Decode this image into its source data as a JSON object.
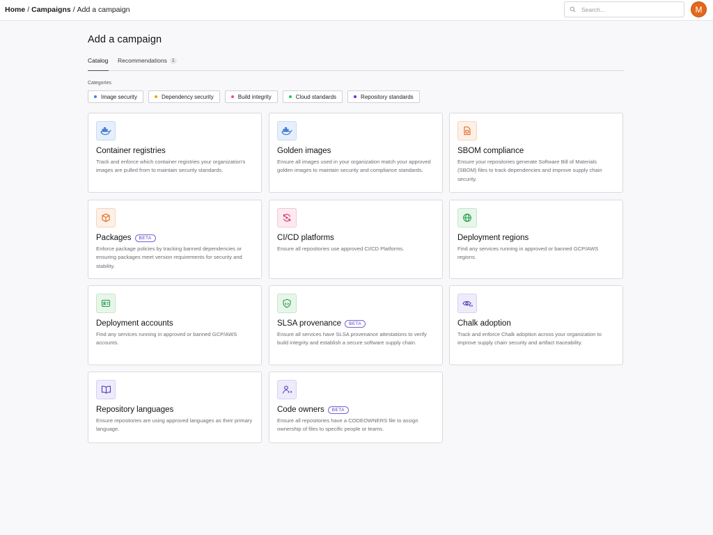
{
  "breadcrumb": {
    "home": "Home",
    "campaigns": "Campaigns",
    "current": "Add a campaign",
    "separator": "/"
  },
  "search": {
    "placeholder": "Search..."
  },
  "user": {
    "avatar_initial": "M",
    "avatar_color": "#e2681d"
  },
  "page": {
    "title": "Add a campaign"
  },
  "tabs": [
    {
      "label": "Catalog",
      "active": true
    },
    {
      "label": "Recommendations",
      "count": "1",
      "active": false
    }
  ],
  "categories": {
    "label": "Categories",
    "items": [
      {
        "label": "Image security",
        "color": "#3b82f6"
      },
      {
        "label": "Dependency security",
        "color": "#f59e0b"
      },
      {
        "label": "Build integrity",
        "color": "#ec4899"
      },
      {
        "label": "Cloud standards",
        "color": "#22c55e"
      },
      {
        "label": "Repository standards",
        "color": "#6d28d9"
      }
    ]
  },
  "beta_label": "BETA",
  "cards": [
    {
      "title": "Container registries",
      "icon": "docker-whale-icon",
      "tint": "blue",
      "desc": "Track and enforce which container registries your organization's images are pulled from to maintain security standards."
    },
    {
      "title": "Golden images",
      "icon": "docker-whale-icon",
      "tint": "blue",
      "desc": "Ensure all images used in your organization match your approved golden images to maintain security and compliance standards."
    },
    {
      "title": "SBOM compliance",
      "icon": "document-box-icon",
      "tint": "orange",
      "desc": "Ensure your repositories generate Software Bill of Materials (SBOM) files to track dependencies and improve supply chain security."
    },
    {
      "title": "Packages",
      "beta": true,
      "icon": "package-icon",
      "tint": "orange",
      "desc": "Enforce package policies by tracking banned dependencies or ensuring packages meet version requirements for security and stability."
    },
    {
      "title": "CI/CD platforms",
      "icon": "refresh-cycle-icon",
      "tint": "red",
      "desc": "Ensure all repositories use approved CI/CD Platforms."
    },
    {
      "title": "Deployment regions",
      "icon": "globe-icon",
      "tint": "green",
      "desc": "Find any services running in approved or banned GCP/AWS regions."
    },
    {
      "title": "Deployment accounts",
      "icon": "id-card-icon",
      "tint": "green",
      "desc": "Find any services running in approved or banned GCP/AWS accounts."
    },
    {
      "title": "SLSA provenance",
      "beta": true,
      "icon": "shield-code-icon",
      "tint": "green",
      "desc": "Ensure all services have SLSA provenance attestations to verify build integrity and establish a secure software supply chain."
    },
    {
      "title": "Chalk adoption",
      "icon": "eye-code-icon",
      "tint": "purple",
      "desc": "Track and enforce Chalk adoption across your organization to improve supply chain security and artifact traceability."
    },
    {
      "title": "Repository languages",
      "icon": "book-open-icon",
      "tint": "purple",
      "desc": "Ensure repositories are using approved languages as their primary language."
    },
    {
      "title": "Code owners",
      "beta": true,
      "icon": "user-code-icon",
      "tint": "purple",
      "desc": "Ensure all repositories have a CODEOWNERS file to assign ownership of files to specific people or teams."
    }
  ]
}
